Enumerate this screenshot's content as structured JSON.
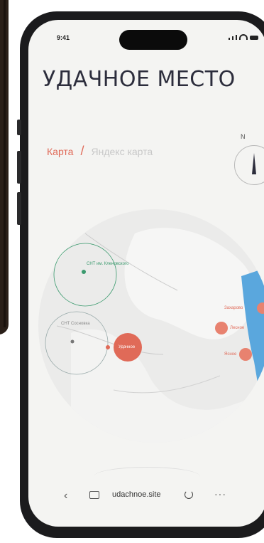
{
  "status_bar": {
    "time": "9:41"
  },
  "header": {
    "title": "УДАЧНОЕ МЕСТО"
  },
  "breadcrumb": {
    "active": "Карта",
    "separator": "/",
    "inactive": "Яндекс карта"
  },
  "compass": {
    "north_label": "N"
  },
  "map_pins": {
    "green_label": "СНТ им. Кленовского",
    "grey_label": "СНТ Сосновка",
    "main_label": "Удачное",
    "right_1": "Захарово",
    "right_2": "Лесное",
    "right_3": "Ясное"
  },
  "browser": {
    "url": "udachnoe.site",
    "more_label": "···",
    "back_label": "‹"
  },
  "colors": {
    "accent": "#e06a58",
    "green": "#3b9a6e",
    "water": "#5aa7dd",
    "map_bg": "#e9e9e7"
  }
}
